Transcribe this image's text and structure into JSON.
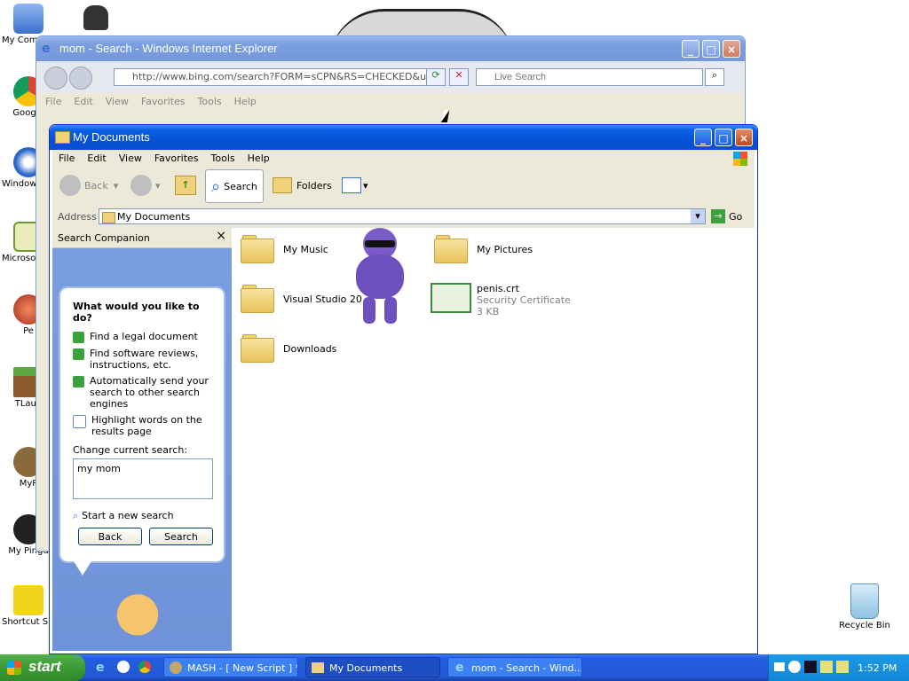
{
  "desktop": {
    "icons": [
      {
        "label": "My Computer",
        "color": "#5b8fd6"
      },
      {
        "label": "Google",
        "color": "#d9452b"
      },
      {
        "label": "Windows Media Player",
        "color": "#2b64c8"
      },
      {
        "label": "Microsoft Outlook",
        "color": "#6f9a2d"
      },
      {
        "label": "Pe",
        "color": "#c0392b"
      },
      {
        "label": "TLaun",
        "color": "#4a8f3a"
      },
      {
        "label": "MyP",
        "color": "#8a6a3a"
      },
      {
        "label": "My Pingu",
        "color": "#222222"
      },
      {
        "label": "Shortcut SpongeBob",
        "color": "#f2d41b"
      }
    ],
    "recycle_bin_label": "Recycle Bin"
  },
  "ie_window": {
    "title": "mom - Search - Windows Internet Explorer",
    "address": "http://www.bing.com/search?FORM=sCPN&RS=CHECKED&un=",
    "search_placeholder": "Live Search",
    "menu": [
      "File",
      "Edit",
      "View",
      "Favorites",
      "Tools",
      "Help"
    ]
  },
  "explorer": {
    "title": "My Documents",
    "menu": [
      "File",
      "Edit",
      "View",
      "Favorites",
      "Tools",
      "Help"
    ],
    "toolbar": {
      "back": "Back",
      "search": "Search",
      "folders": "Folders"
    },
    "address_label": "Address",
    "address_value": "My Documents",
    "go_label": "Go",
    "companion": {
      "title": "Search Companion",
      "close": "×",
      "question": "What would you like to do?",
      "tasks": [
        "Find a legal document",
        "Find software reviews, instructions, etc.",
        "Automatically send your search to other search engines",
        "Highlight words on the results page"
      ],
      "change_label": "Change current search:",
      "search_value": "my mom",
      "new_search": "Start a new search",
      "back_btn": "Back",
      "search_btn": "Search"
    },
    "files": [
      {
        "name": "My Music"
      },
      {
        "name": "My Pictures"
      },
      {
        "name": "Visual Studio 20"
      },
      {
        "name": "penis.crt",
        "type": "Security Certificate",
        "size": "3 KB"
      },
      {
        "name": "Downloads"
      }
    ]
  },
  "taskbar": {
    "start": "start",
    "items": [
      "MASH - [ New Script ] *",
      "My Documents",
      "mom - Search - Wind..."
    ],
    "clock": "1:52 PM"
  }
}
